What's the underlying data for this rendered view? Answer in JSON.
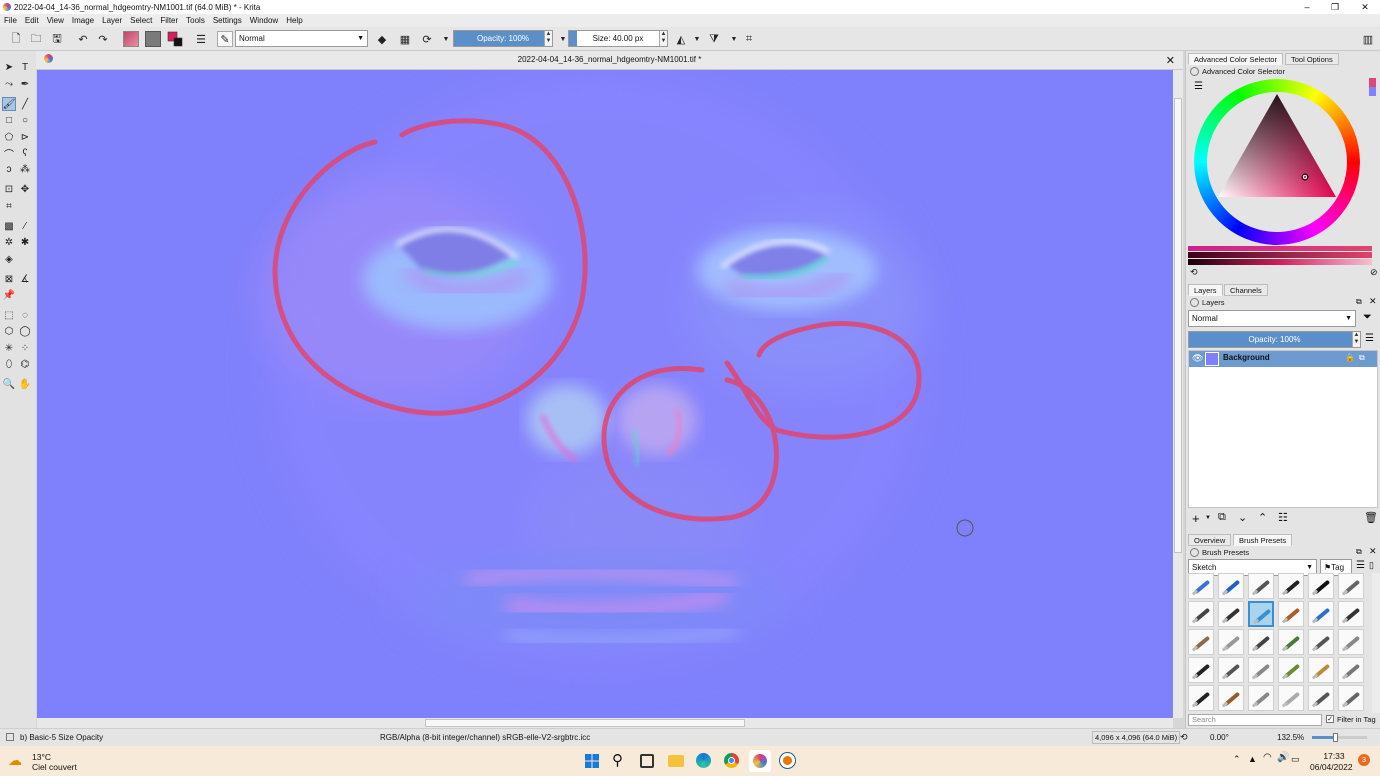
{
  "window": {
    "title": "2022-04-04_14-36_normal_hdgeomtry-NM1001.tif (64.0 MiB)  * - Krita",
    "controls": [
      "–",
      "❐",
      "✕"
    ]
  },
  "menu": [
    "File",
    "Edit",
    "View",
    "Image",
    "Layer",
    "Select",
    "Filter",
    "Tools",
    "Settings",
    "Window",
    "Help"
  ],
  "toolbar": {
    "blend_mode": "Normal",
    "opacity_label": "Opacity: 100%",
    "opacity_fraction": 1.0,
    "size_label": "Size: 40.00 px",
    "size_fraction": 0.08
  },
  "document": {
    "tab_title": "2022-04-04_14-36_normal_hdgeomtry-NM1001.tif *",
    "close_glyph": "✕"
  },
  "dock": {
    "tabs": [
      "Advanced Color Selector",
      "Tool Options"
    ],
    "color_selector_title": "Advanced Color Selector",
    "layer_tabs": [
      "Layers",
      "Channels"
    ],
    "layers_title": "Layers",
    "layer_blend": "Normal",
    "layer_opacity": "Opacity:  100%",
    "layers": [
      {
        "name": "Background",
        "visible": true,
        "selected": true
      }
    ],
    "bottom_tabs": [
      "Overview",
      "Brush Presets"
    ],
    "brush_title": "Brush Presets",
    "brush_tag_combo": "Sketch",
    "tag_label": "Tag",
    "search_placeholder": "Search",
    "filter_in_tag": "Filter in Tag"
  },
  "status": {
    "brush_name": "b) Basic-5 Size Opacity",
    "color_space": "RGB/Alpha (8-bit integer/channel)  sRGB-elle-V2-srgbtrc.icc",
    "image_size": "4,096 x 4,096 (64.0 MiB)",
    "rotation": "0.00°",
    "zoom": "132.5%",
    "zoom_fraction": 0.42
  },
  "taskbar": {
    "temperature": "13°C",
    "weather": "Ciel couvert",
    "time": "17:33",
    "date": "06/04/2022",
    "notification_count": "3"
  },
  "colors": {
    "canvas_normal": "#8080ff",
    "annotation": "#e0456e",
    "accent": "#5b8fc9",
    "taskbar": "#f7ead9"
  }
}
